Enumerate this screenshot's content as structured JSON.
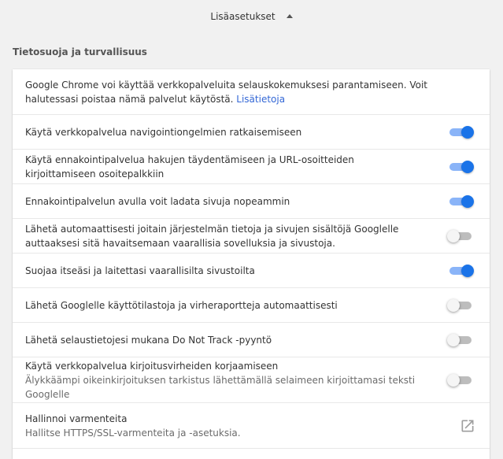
{
  "header": {
    "advanced_label": "Lisäasetukset",
    "arrow_icon": "arrow-up-icon"
  },
  "section": {
    "title": "Tietosuoja ja turvallisuus"
  },
  "intro": {
    "text": "Google Chrome voi käyttää verkkopalveluita selauskokemuksesi parantamiseen. Voit halutessasi poistaa nämä palvelut käytöstä.",
    "link": "Lisätietoja"
  },
  "settings": [
    {
      "label": "Käytä verkkopalvelua navigointiongelmien ratkaisemiseen",
      "enabled": true
    },
    {
      "label": "Käytä ennakointipalvelua hakujen täydentämiseen ja URL-osoitteiden kirjoittamiseen osoitepalkkiin",
      "enabled": true
    },
    {
      "label": "Ennakointipalvelun avulla voit ladata sivuja nopeammin",
      "enabled": true
    },
    {
      "label": "Lähetä automaattisesti joitain järjestelmän tietoja ja sivujen sisältöjä Googlelle auttaaksesi sitä havaitsemaan vaarallisia sovelluksia ja sivustoja.",
      "enabled": false
    },
    {
      "label": "Suojaa itseäsi ja laitettasi vaarallisilta sivustoilta",
      "enabled": true
    },
    {
      "label": "Lähetä Googlelle käyttötilastoja ja virheraportteja automaattisesti",
      "enabled": false
    },
    {
      "label": "Lähetä selaustietojesi mukana Do Not Track -pyyntö",
      "enabled": false
    },
    {
      "label": "Käytä verkkopalvelua kirjoitusvirheiden korjaamiseen",
      "sublabel": "Älykkäämpi oikeinkirjoituksen tarkistus lähettämällä selaimeen kirjoittamasi teksti Googlelle",
      "enabled": false
    }
  ],
  "certificates": {
    "title": "Hallinnoi varmenteita",
    "subtitle": "Hallitse HTTPS/SSL-varmenteita ja -asetuksia.",
    "icon": "open-in-new-icon"
  },
  "colors": {
    "accent": "#1a73e8",
    "accent_track": "#8ab4f8",
    "link": "#3367d6",
    "background": "#f1f1f1"
  }
}
